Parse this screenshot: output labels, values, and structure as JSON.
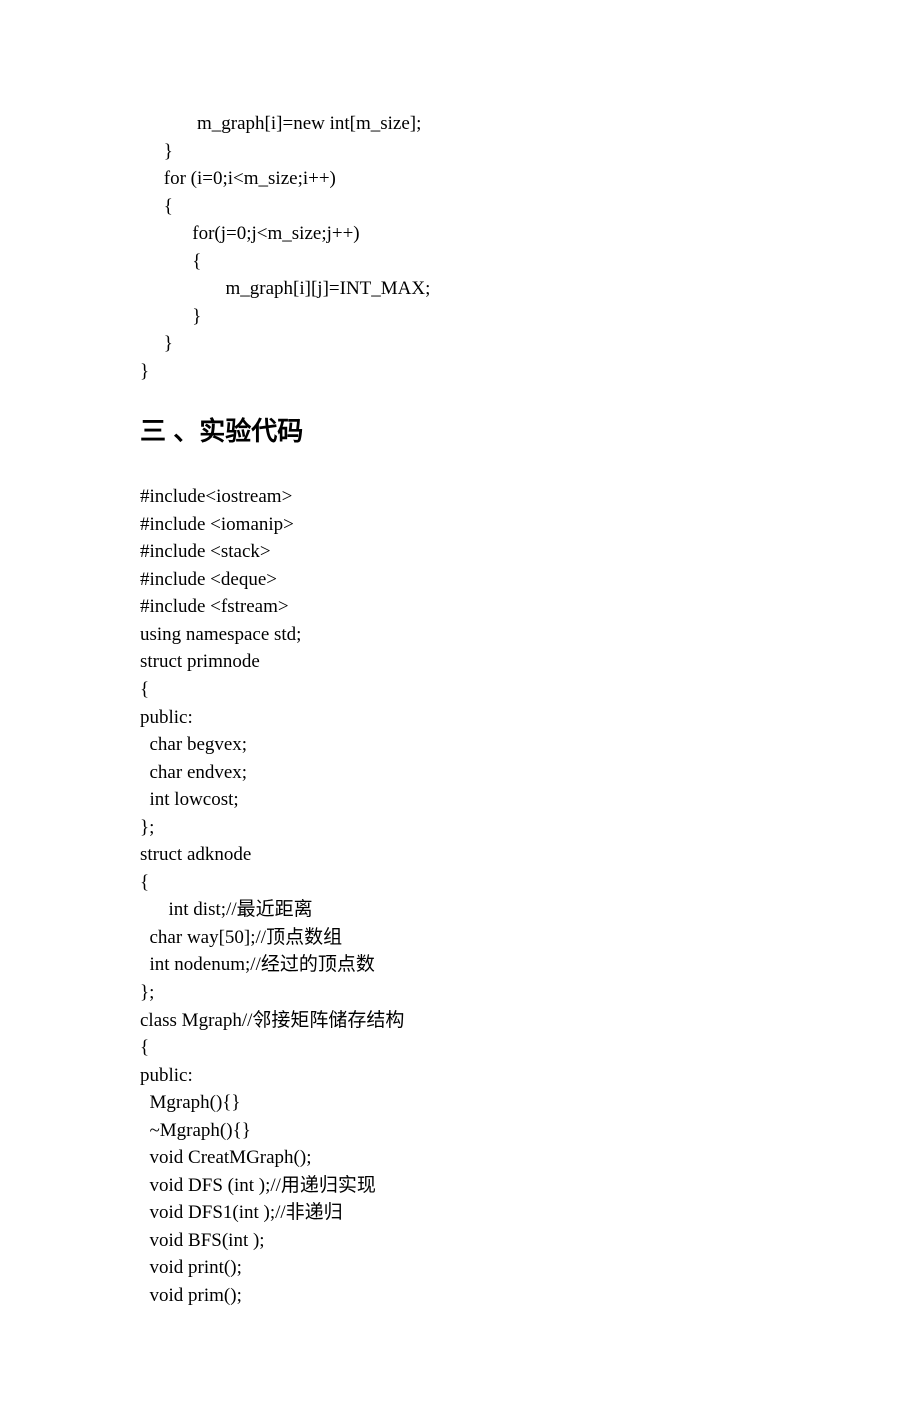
{
  "block1_lines": [
    "            m_graph[i]=new int[m_size];",
    "     }",
    "     for (i=0;i<m_size;i++)",
    "     {",
    "           for(j=0;j<m_size;j++)",
    "           {",
    "                  m_graph[i][j]=INT_MAX;",
    "           }",
    "     }",
    "}"
  ],
  "heading": "三 、实验代码",
  "block2_lines": [
    "#include<iostream>",
    "#include <iomanip>",
    "#include <stack>",
    "#include <deque>",
    "#include <fstream>",
    "using namespace std;",
    "struct primnode",
    "{",
    "public:",
    "  char begvex;",
    "  char endvex;",
    "  int lowcost;",
    "};",
    "struct adknode",
    "{",
    "      int dist;//最近距离",
    "  char way[50];//顶点数组",
    "  int nodenum;//经过的顶点数",
    "};",
    "class Mgraph//邻接矩阵储存结构",
    "{",
    "public:",
    "  Mgraph(){}",
    "  ~Mgraph(){}",
    "  void CreatMGraph();",
    "  void DFS (int );//用递归实现",
    "  void DFS1(int );//非递归",
    "  void BFS(int );",
    "  void print();",
    "  void prim();"
  ]
}
